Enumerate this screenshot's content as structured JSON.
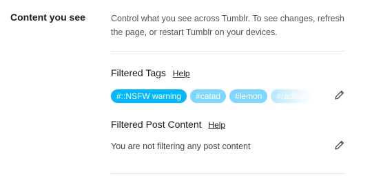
{
  "section": {
    "title": "Content you see",
    "description": "Control what you see across Tumblr. To see changes, refresh the page, or restart Tumblr on your devices."
  },
  "filtered_tags": {
    "heading": "Filtered Tags",
    "help_label": "Help",
    "tags": [
      "#::NSFW warning",
      "#catad",
      "#lemon",
      "#radical"
    ],
    "edit_icon": "pencil-icon"
  },
  "filtered_post_content": {
    "heading": "Filtered Post Content",
    "help_label": "Help",
    "empty_text": "You are not filtering any post content",
    "edit_icon": "pencil-icon"
  },
  "colors": {
    "tag_background": "#00b8ff",
    "divider": "#e3e3e3"
  }
}
